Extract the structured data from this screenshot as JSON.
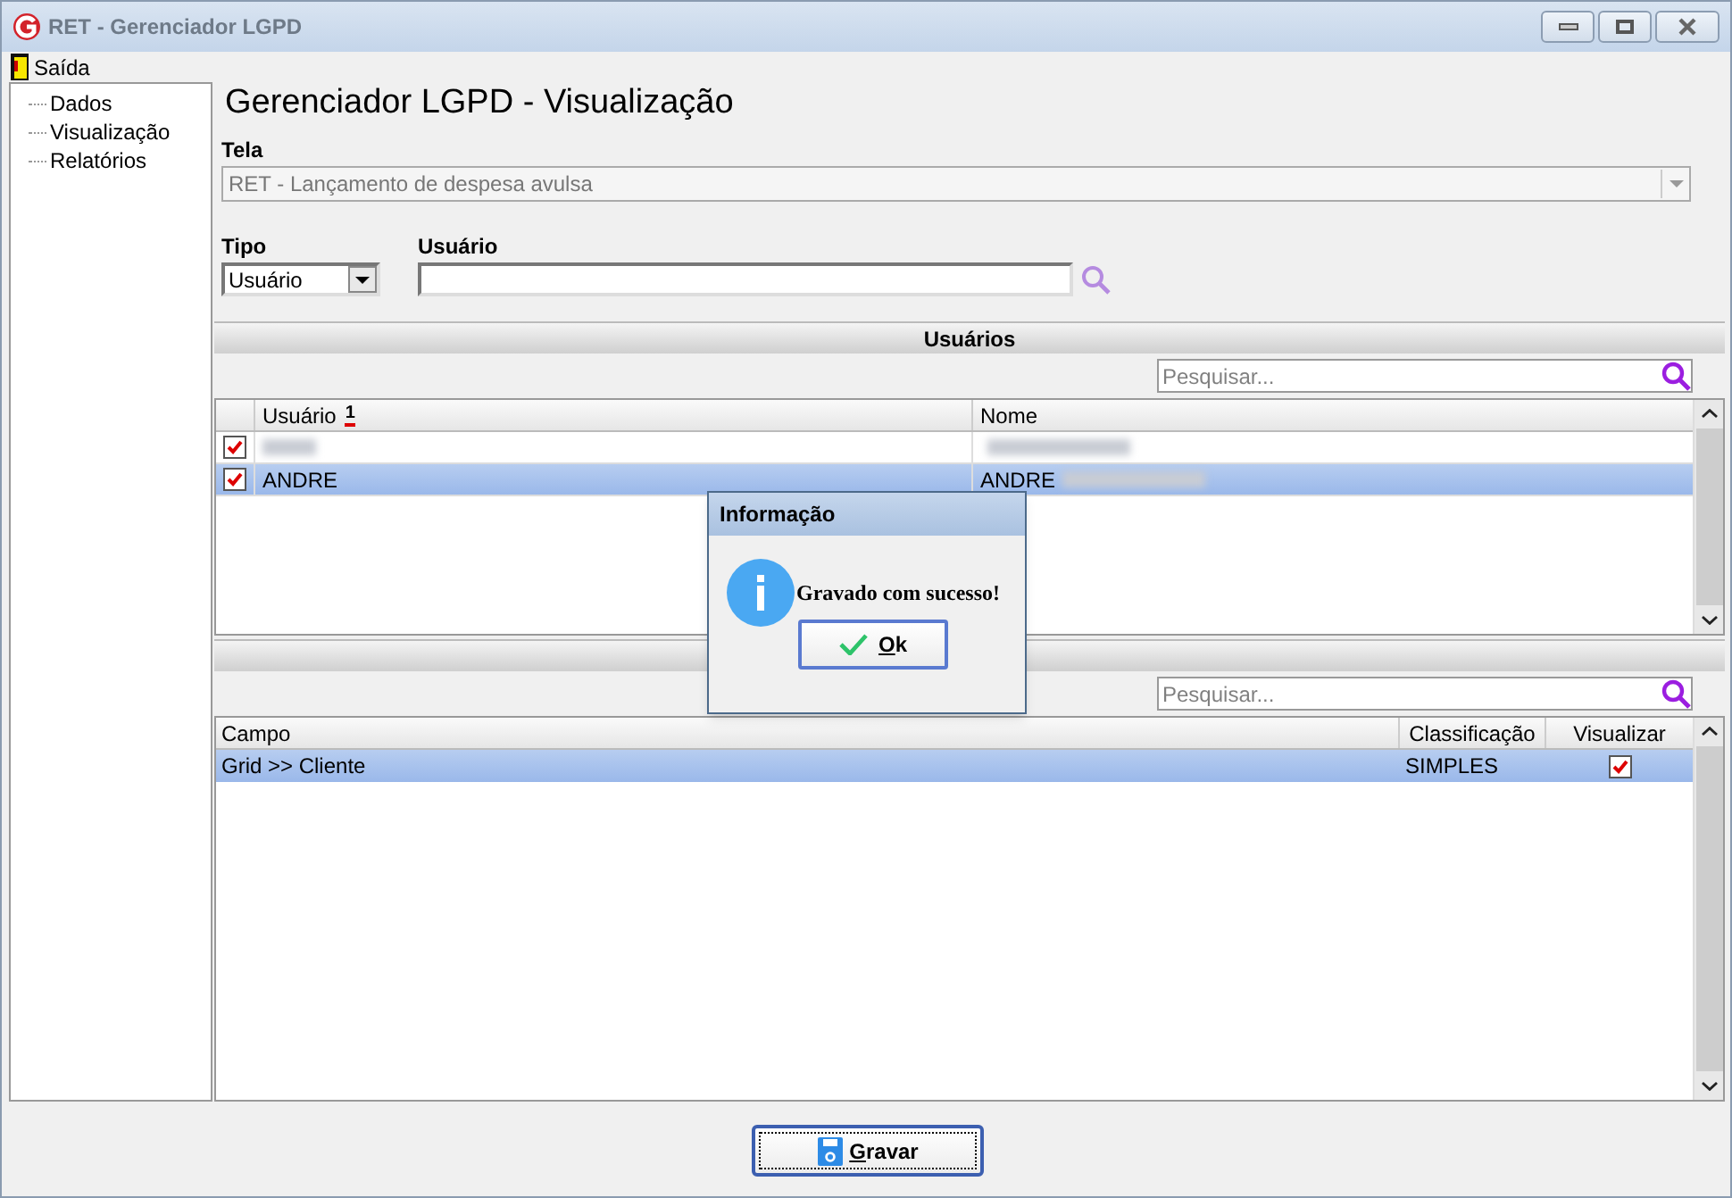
{
  "window": {
    "title": "RET - Gerenciador LGPD"
  },
  "menu": [
    {
      "label": "Saída"
    }
  ],
  "sidebar": {
    "items": [
      {
        "label": "Dados"
      },
      {
        "label": "Visualização"
      },
      {
        "label": "Relatórios"
      }
    ]
  },
  "page_title": "Gerenciador LGPD - Visualização",
  "tela": {
    "label": "Tela",
    "value": "RET - Lançamento de despesa avulsa"
  },
  "tipo": {
    "label": "Tipo",
    "value": "Usuário"
  },
  "usuario": {
    "label": "Usuário"
  },
  "users_panel": {
    "title": "Usuários",
    "search": {
      "placeholder": "Pesquisar..."
    },
    "columns": [
      {
        "label": "Usuário",
        "sort_mark": "1"
      },
      {
        "label": "Nome"
      }
    ],
    "rows": [
      {
        "checked": true,
        "selected": false,
        "blurred": true
      },
      {
        "checked": true,
        "selected": true,
        "usuario": "ANDRE",
        "nome": "ANDRE",
        "blurred": true
      }
    ]
  },
  "fields_panel": {
    "search": {
      "placeholder": "Pesquisar..."
    },
    "columns": [
      {
        "label": "Campo"
      },
      {
        "label": "Classificação"
      },
      {
        "label": "Visualizar"
      }
    ],
    "rows": [
      {
        "campo": "Grid >> Cliente",
        "classificacao": "SIMPLES",
        "visualizar": true,
        "selected": true
      }
    ]
  },
  "dialog": {
    "title": "Informação",
    "message": "Gravado com sucesso!",
    "button": "Ok"
  },
  "save_button": "Gravar"
}
